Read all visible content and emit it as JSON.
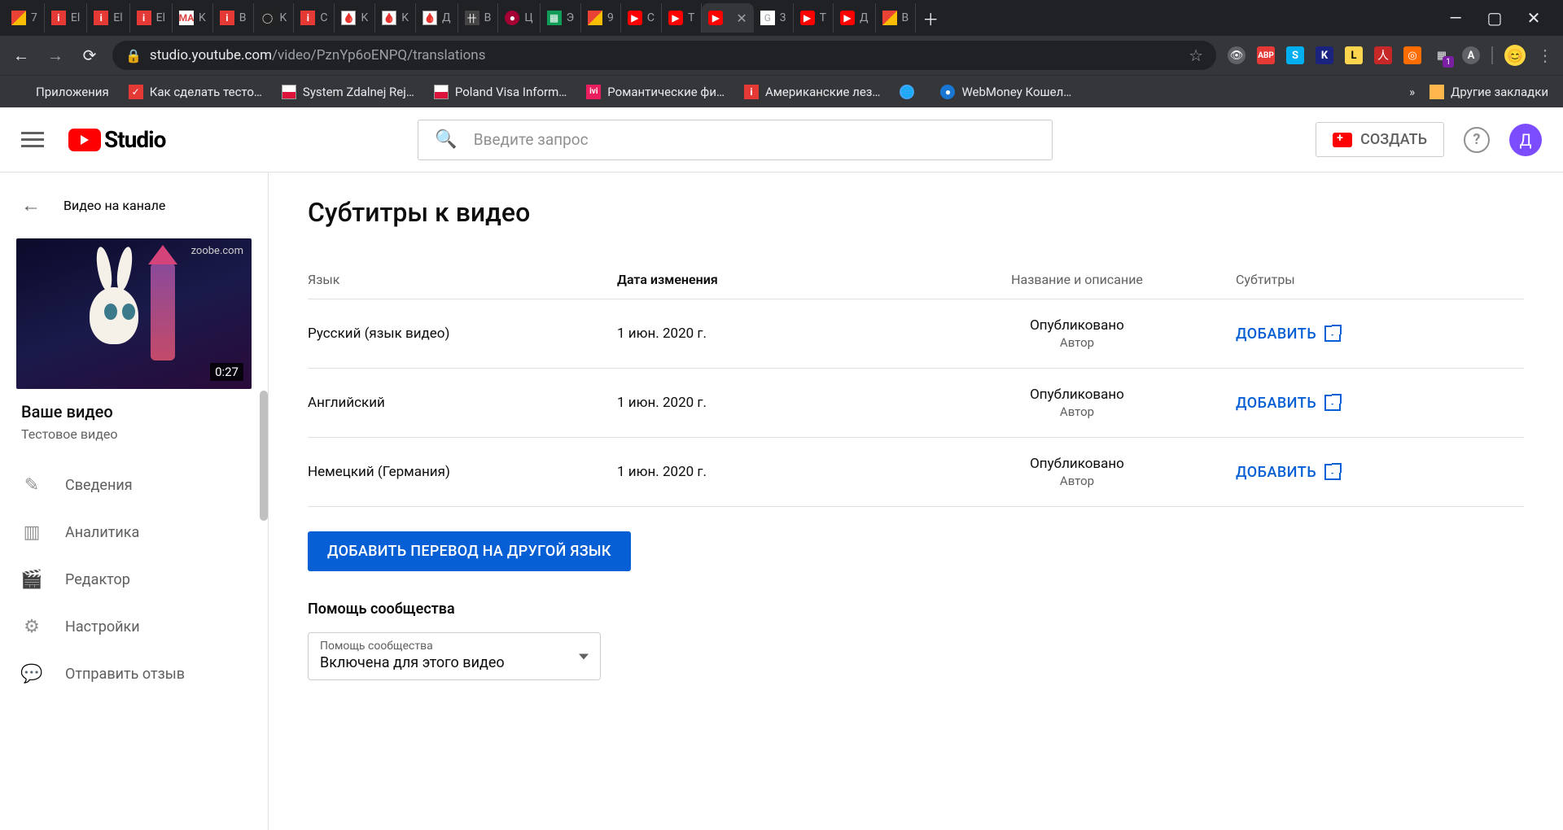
{
  "browser": {
    "tabs": [
      {
        "title": "7",
        "icon": "gmail"
      },
      {
        "title": "El",
        "icon": "i-red"
      },
      {
        "title": "El",
        "icon": "i-red"
      },
      {
        "title": "El",
        "icon": "i-red"
      },
      {
        "title": "K",
        "icon": "ma"
      },
      {
        "title": "B",
        "icon": "i-red"
      },
      {
        "title": "K",
        "icon": "oct"
      },
      {
        "title": "C",
        "icon": "i-red"
      },
      {
        "title": "K",
        "icon": "blood"
      },
      {
        "title": "K",
        "icon": "blood"
      },
      {
        "title": "Д",
        "icon": "blood"
      },
      {
        "title": "B",
        "icon": "book"
      },
      {
        "title": "Ц",
        "icon": "lg"
      },
      {
        "title": "Э",
        "icon": "sheets"
      },
      {
        "title": "9",
        "icon": "gmail"
      },
      {
        "title": "C",
        "icon": "yt"
      },
      {
        "title": "T",
        "icon": "yt"
      },
      {
        "title": "",
        "icon": "yt",
        "active": true,
        "closable": true
      },
      {
        "title": "3",
        "icon": "google"
      },
      {
        "title": "T",
        "icon": "yt"
      },
      {
        "title": "Д",
        "icon": "yt"
      },
      {
        "title": "В",
        "icon": "gmail"
      }
    ],
    "url_domain": "studio.youtube.com",
    "url_path": "/video/PznYp6oENPQ/translations",
    "bookmarks": {
      "apps_label": "Приложения",
      "items": [
        {
          "label": "Как сделать тесто…",
          "icon": "chk"
        },
        {
          "label": "System Zdalnej Rej…",
          "icon": "pl"
        },
        {
          "label": "Poland Visa Inform…",
          "icon": "pl"
        },
        {
          "label": "Романтические фи…",
          "icon": "ivi"
        },
        {
          "label": "Американские лез…",
          "icon": "i-red"
        },
        {
          "label": "",
          "icon": "globe"
        },
        {
          "label": "WebMoney Кошел…",
          "icon": "wm"
        }
      ],
      "overflow": "»",
      "other_label": "Другие закладки"
    }
  },
  "header": {
    "logo_text": "Studio",
    "search_placeholder": "Введите запрос",
    "create_label": "СОЗДАТЬ",
    "avatar_letter": "Д"
  },
  "sidebar": {
    "back_label": "Видео на канале",
    "thumb_watermark": "zoobe.com",
    "thumb_duration": "0:27",
    "video_title": "Ваше видео",
    "video_subtitle": "Тестовое видео",
    "nav": [
      {
        "label": "Сведения",
        "icon": "✎"
      },
      {
        "label": "Аналитика",
        "icon": "▥"
      },
      {
        "label": "Редактор",
        "icon": "🎬"
      },
      {
        "label": "Настройки",
        "icon": "⚙"
      },
      {
        "label": "Отправить отзыв",
        "icon": "💬"
      }
    ]
  },
  "content": {
    "title": "Субтитры к видео",
    "columns": {
      "lang": "Язык",
      "date": "Дата изменения",
      "desc": "Название и описание",
      "subs": "Субтитры"
    },
    "rows": [
      {
        "lang": "Русский (язык видео)",
        "date": "1 июн. 2020 г.",
        "status": "Опубликовано",
        "author": "Автор",
        "action": "ДОБАВИТЬ"
      },
      {
        "lang": "Английский",
        "date": "1 июн. 2020 г.",
        "status": "Опубликовано",
        "author": "Автор",
        "action": "ДОБАВИТЬ"
      },
      {
        "lang": "Немецкий (Германия)",
        "date": "1 июн. 2020 г.",
        "status": "Опубликовано",
        "author": "Автор",
        "action": "ДОБАВИТЬ"
      }
    ],
    "add_lang_button": "ДОБАВИТЬ ПЕРЕВОД НА ДРУГОЙ ЯЗЫК",
    "community_heading": "Помощь сообщества",
    "dropdown": {
      "label": "Помощь сообщества",
      "value": "Включена для этого видео"
    }
  }
}
